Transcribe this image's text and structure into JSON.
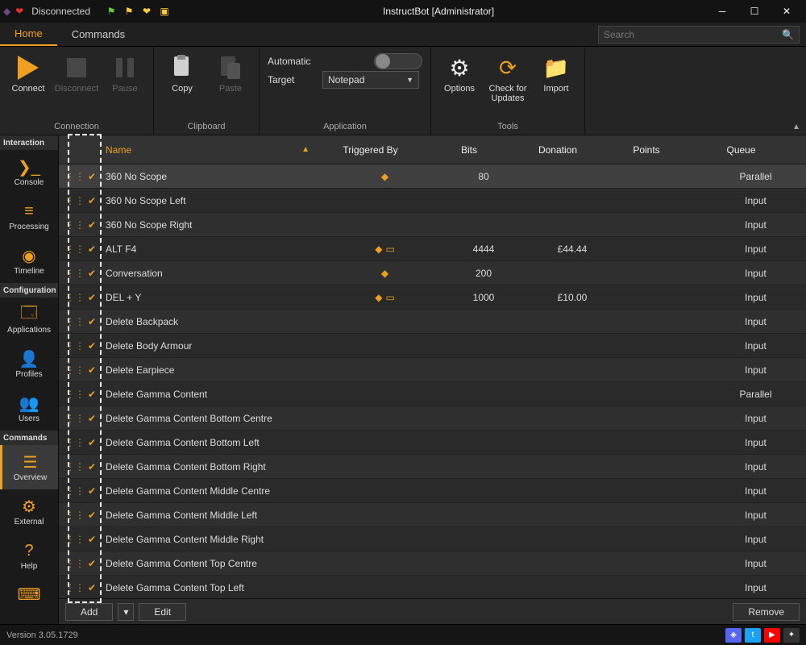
{
  "title": "InstructBot [Administrator]",
  "connection_status": "Disconnected",
  "tabs": {
    "home": "Home",
    "commands": "Commands"
  },
  "search": {
    "placeholder": "Search"
  },
  "ribbon": {
    "connection": {
      "connect": "Connect",
      "disconnect": "Disconnect",
      "pause": "Pause",
      "label": "Connection"
    },
    "clipboard": {
      "copy": "Copy",
      "paste": "Paste",
      "label": "Clipboard"
    },
    "application": {
      "automatic": "Automatic",
      "target": "Target",
      "target_value": "Notepad",
      "label": "Application"
    },
    "tools": {
      "options": "Options",
      "check": "Check for Updates",
      "import": "Import",
      "label": "Tools"
    }
  },
  "sidebar": {
    "sec_interaction": "Interaction",
    "console": "Console",
    "processing": "Processing",
    "timeline": "Timeline",
    "sec_configuration": "Configuration",
    "applications": "Applications",
    "profiles": "Profiles",
    "users": "Users",
    "sec_commands": "Commands",
    "overview": "Overview",
    "external": "External",
    "help": "Help"
  },
  "table": {
    "headers": {
      "name": "Name",
      "triggered": "Triggered By",
      "bits": "Bits",
      "donation": "Donation",
      "points": "Points",
      "queue": "Queue"
    },
    "rows": [
      {
        "name": "360 No Scope",
        "trig": [
          "diamond"
        ],
        "bits": "80",
        "donation": "",
        "points": "",
        "queue": "Parallel",
        "sel": true
      },
      {
        "name": "360 No Scope Left",
        "trig": [],
        "bits": "",
        "donation": "",
        "points": "",
        "queue": "Input"
      },
      {
        "name": "360 No Scope Right",
        "trig": [],
        "bits": "",
        "donation": "",
        "points": "",
        "queue": "Input"
      },
      {
        "name": "ALT F4",
        "trig": [
          "diamond",
          "box"
        ],
        "bits": "4444",
        "donation": "£44.44",
        "points": "",
        "queue": "Input"
      },
      {
        "name": "Conversation",
        "trig": [
          "diamond"
        ],
        "bits": "200",
        "donation": "",
        "points": "",
        "queue": "Input"
      },
      {
        "name": "DEL + Y",
        "trig": [
          "diamond",
          "box"
        ],
        "bits": "1000",
        "donation": "£10.00",
        "points": "",
        "queue": "Input"
      },
      {
        "name": "Delete Backpack",
        "trig": [],
        "bits": "",
        "donation": "",
        "points": "",
        "queue": "Input"
      },
      {
        "name": "Delete Body Armour",
        "trig": [],
        "bits": "",
        "donation": "",
        "points": "",
        "queue": "Input"
      },
      {
        "name": "Delete Earpiece",
        "trig": [],
        "bits": "",
        "donation": "",
        "points": "",
        "queue": "Input"
      },
      {
        "name": "Delete Gamma Content",
        "trig": [],
        "bits": "",
        "donation": "",
        "points": "",
        "queue": "Parallel"
      },
      {
        "name": "Delete Gamma Content Bottom Centre",
        "trig": [],
        "bits": "",
        "donation": "",
        "points": "",
        "queue": "Input"
      },
      {
        "name": "Delete Gamma Content Bottom Left",
        "trig": [],
        "bits": "",
        "donation": "",
        "points": "",
        "queue": "Input"
      },
      {
        "name": "Delete Gamma Content Bottom Right",
        "trig": [],
        "bits": "",
        "donation": "",
        "points": "",
        "queue": "Input"
      },
      {
        "name": "Delete Gamma Content Middle Centre",
        "trig": [],
        "bits": "",
        "donation": "",
        "points": "",
        "queue": "Input"
      },
      {
        "name": "Delete Gamma Content Middle Left",
        "trig": [],
        "bits": "",
        "donation": "",
        "points": "",
        "queue": "Input"
      },
      {
        "name": "Delete Gamma Content Middle Right",
        "trig": [],
        "bits": "",
        "donation": "",
        "points": "",
        "queue": "Input"
      },
      {
        "name": "Delete Gamma Content Top Centre",
        "trig": [],
        "bits": "",
        "donation": "",
        "points": "",
        "queue": "Input"
      },
      {
        "name": "Delete Gamma Content Top Left",
        "trig": [],
        "bits": "",
        "donation": "",
        "points": "",
        "queue": "Input"
      }
    ]
  },
  "buttons": {
    "add": "Add",
    "edit": "Edit",
    "remove": "Remove"
  },
  "status": {
    "version": "Version 3.05.1729"
  }
}
